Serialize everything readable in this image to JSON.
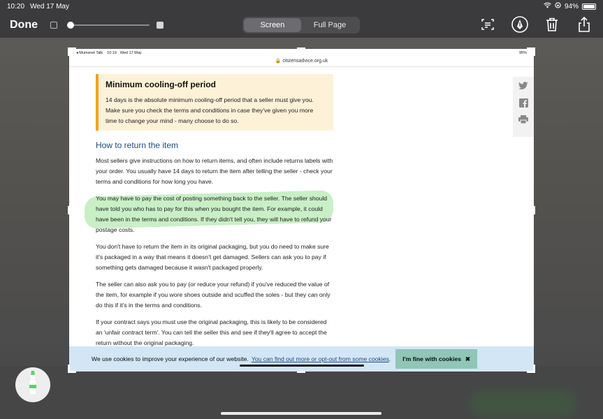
{
  "status_bar": {
    "time": "10:20",
    "date": "Wed 17 May",
    "battery": "94%"
  },
  "toolbar": {
    "done_label": "Done",
    "segments": [
      "Screen",
      "Full Page"
    ],
    "active_segment": "Screen",
    "icons": [
      "crop-text-icon",
      "markup-pen-icon",
      "trash-icon",
      "share-icon"
    ]
  },
  "screenshot": {
    "status": {
      "app": "◂ Mumsnet Talk",
      "time": "10:19",
      "date": "Wed 17 May",
      "battery": "95%"
    },
    "url": "citizensadvice.org.uk",
    "callout": {
      "title": "Minimum cooling-off period",
      "body": "14 days is the absolute minimum cooling-off period that a seller must give you. Make sure you check the terms and conditions in case they've given you more time to change your mind - many choose to do so."
    },
    "section_heading": "How to return the item",
    "paragraphs": [
      "Most sellers give instructions on how to return items, and often include returns labels with your order. You usually have 14 days to return the item after telling the seller - check your terms and conditions for how long you have.",
      "You may have to pay the cost of posting something back to the seller. The seller should have told you who has to pay for this when you bought the item. For example, it could have been in the terms and conditions. If they didn't tell you, they will have to refund your postage costs.",
      "You don't have to return the item in its original packaging, but you do need to make sure it's packaged in a way that means it doesn't get damaged. Sellers can ask you to pay if something gets damaged because it wasn't packaged properly.",
      "The seller can also ask you to pay (or reduce your refund) if you've reduced the value of the item, for example if you wore shoes outside and scuffed the soles - but they can only do this if it's in the terms and conditions.",
      "If your contract says you must use the original packaging, this is likely to be considered an 'unfair contract term'. You can tell the seller this and see if they'll agree to accept the return without the original packaging."
    ],
    "cookie": {
      "text": "We use cookies to improve your experience of our website.",
      "link": "You can find out more or opt-out from some cookies",
      "suffix": ".",
      "button": "I'm fine with cookies"
    }
  },
  "colors": {
    "highlight": "#c6eec3",
    "callout_border": "#f2a21e",
    "heading": "#1d4b7c",
    "cookie_bg": "#d2e6f5",
    "cookie_button": "#8fc6b6"
  }
}
